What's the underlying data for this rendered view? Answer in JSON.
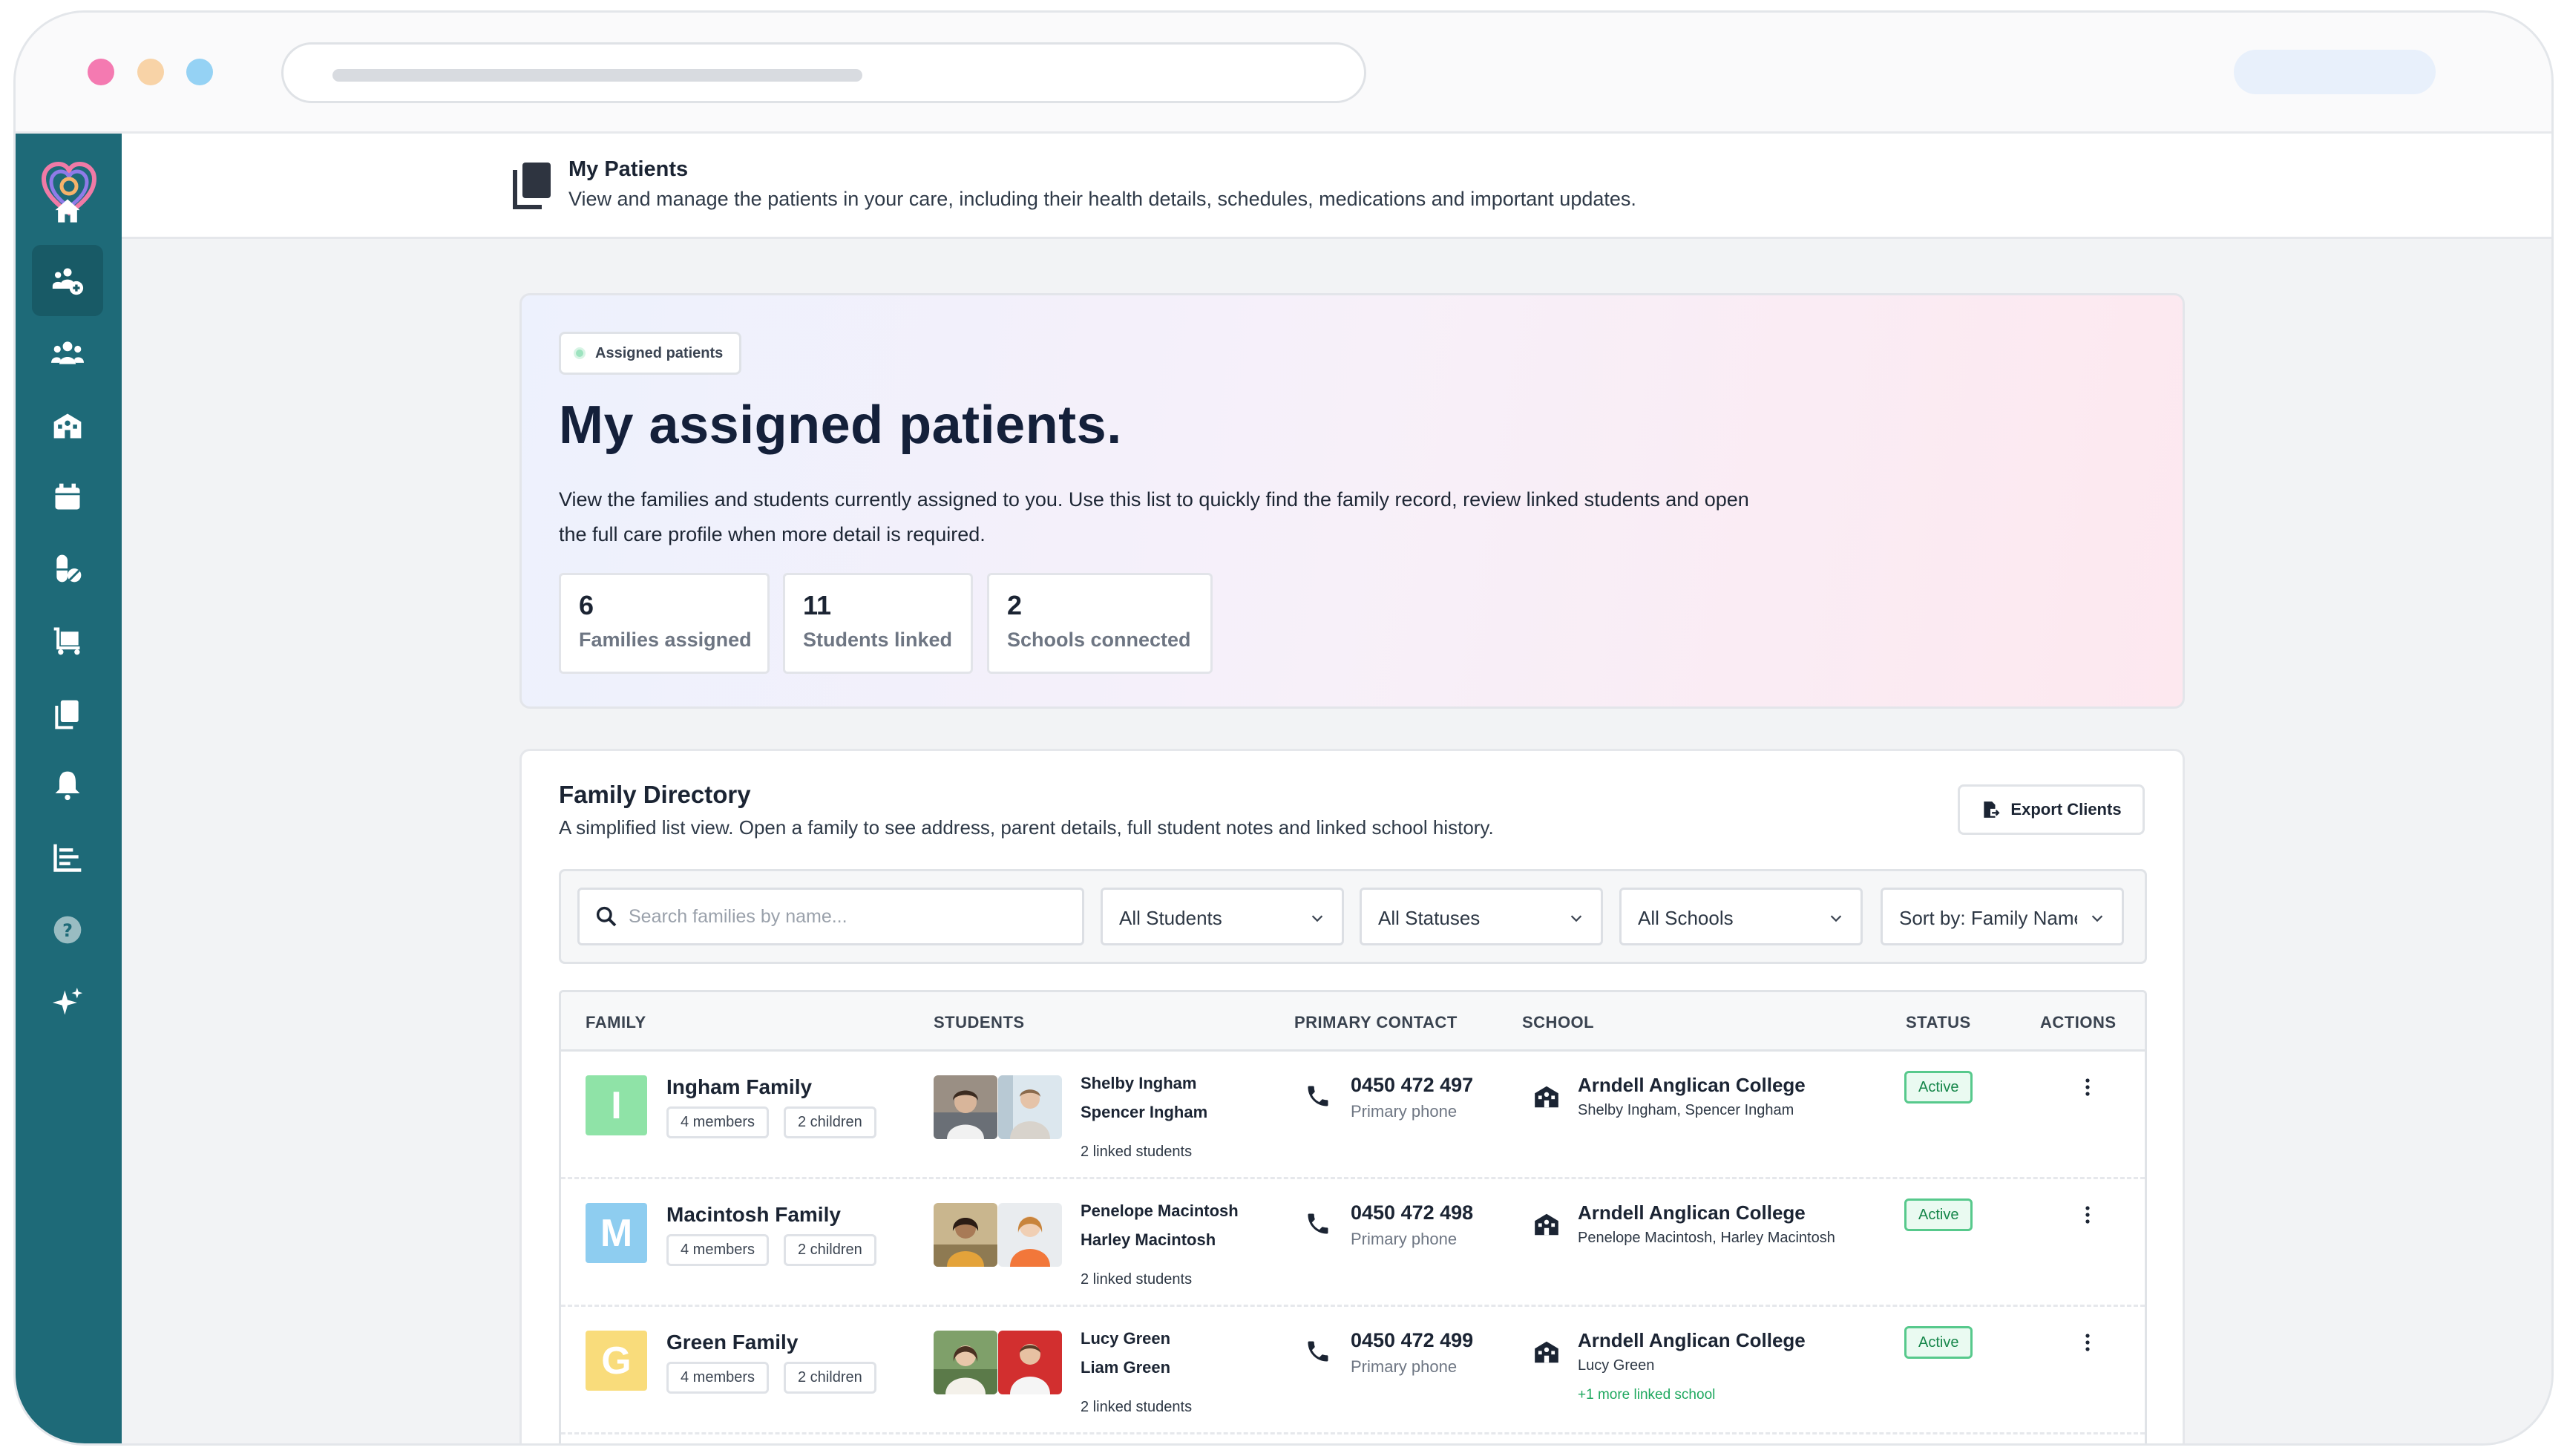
{
  "header": {
    "title": "My Patients",
    "subtitle": "View and manage the patients in your care, including their health details, schedules, medications and important updates."
  },
  "sidebar": {
    "items": [
      {
        "name": "home-icon"
      },
      {
        "name": "manage-patients-icon",
        "active": true
      },
      {
        "name": "people-icon"
      },
      {
        "name": "school-icon"
      },
      {
        "name": "calendar-icon"
      },
      {
        "name": "medication-icon"
      },
      {
        "name": "cart-icon"
      },
      {
        "name": "documents-icon"
      },
      {
        "name": "bell-icon"
      },
      {
        "name": "reports-icon"
      },
      {
        "name": "help-icon"
      },
      {
        "name": "sparkles-icon"
      }
    ]
  },
  "hero": {
    "chip": "Assigned patients",
    "title": "My assigned patients.",
    "description": "View the families and students currently assigned to you. Use this list to quickly find the family record, review linked students and open the full care profile when more detail is required.",
    "stats": [
      {
        "value": "6",
        "label": "Families assigned"
      },
      {
        "value": "11",
        "label": "Students linked"
      },
      {
        "value": "2",
        "label": "Schools connected"
      }
    ]
  },
  "directory": {
    "title": "Family Directory",
    "subtitle": "A simplified list view. Open a family to see address, parent details, full student notes and linked school history.",
    "export_label": "Export Clients",
    "search_placeholder": "Search families by name...",
    "filters": [
      "All Students",
      "All Statuses",
      "All Schools",
      "Sort by: Family Name"
    ],
    "columns": [
      "FAMILY",
      "STUDENTS",
      "PRIMARY CONTACT",
      "SCHOOL",
      "STATUS",
      "ACTIONS"
    ],
    "rows": [
      {
        "initial": "I",
        "color": "#8fe3a7",
        "family": "Ingham Family",
        "members": "4 members",
        "children": "2 children",
        "students": [
          "Shelby Ingham",
          "Spencer Ingham"
        ],
        "linked": "2 linked students",
        "phone": "0450 472 497",
        "phone_label": "Primary phone",
        "school": "Arndell Anglican College",
        "school_students": "Shelby Ingham, Spencer Ingham",
        "more": "",
        "status": "Active"
      },
      {
        "initial": "M",
        "color": "#8ecdf0",
        "family": "Macintosh Family",
        "members": "4 members",
        "children": "2 children",
        "students": [
          "Penelope Macintosh",
          "Harley Macintosh"
        ],
        "linked": "2 linked students",
        "phone": "0450 472 498",
        "phone_label": "Primary phone",
        "school": "Arndell Anglican College",
        "school_students": "Penelope Macintosh, Harley Macintosh",
        "more": "",
        "status": "Active"
      },
      {
        "initial": "G",
        "color": "#f9dc7b",
        "family": "Green Family",
        "members": "4 members",
        "children": "2 children",
        "students": [
          "Lucy Green",
          "Liam Green"
        ],
        "linked": "2 linked students",
        "phone": "0450 472 499",
        "phone_label": "Primary phone",
        "school": "Arndell Anglican College",
        "school_students": "Lucy Green",
        "more": "+1 more linked school",
        "status": "Active"
      }
    ]
  },
  "colors": {
    "sidebar": "#1e6a78",
    "sidebar_active": "#185a66",
    "status_green": "#16864a"
  }
}
